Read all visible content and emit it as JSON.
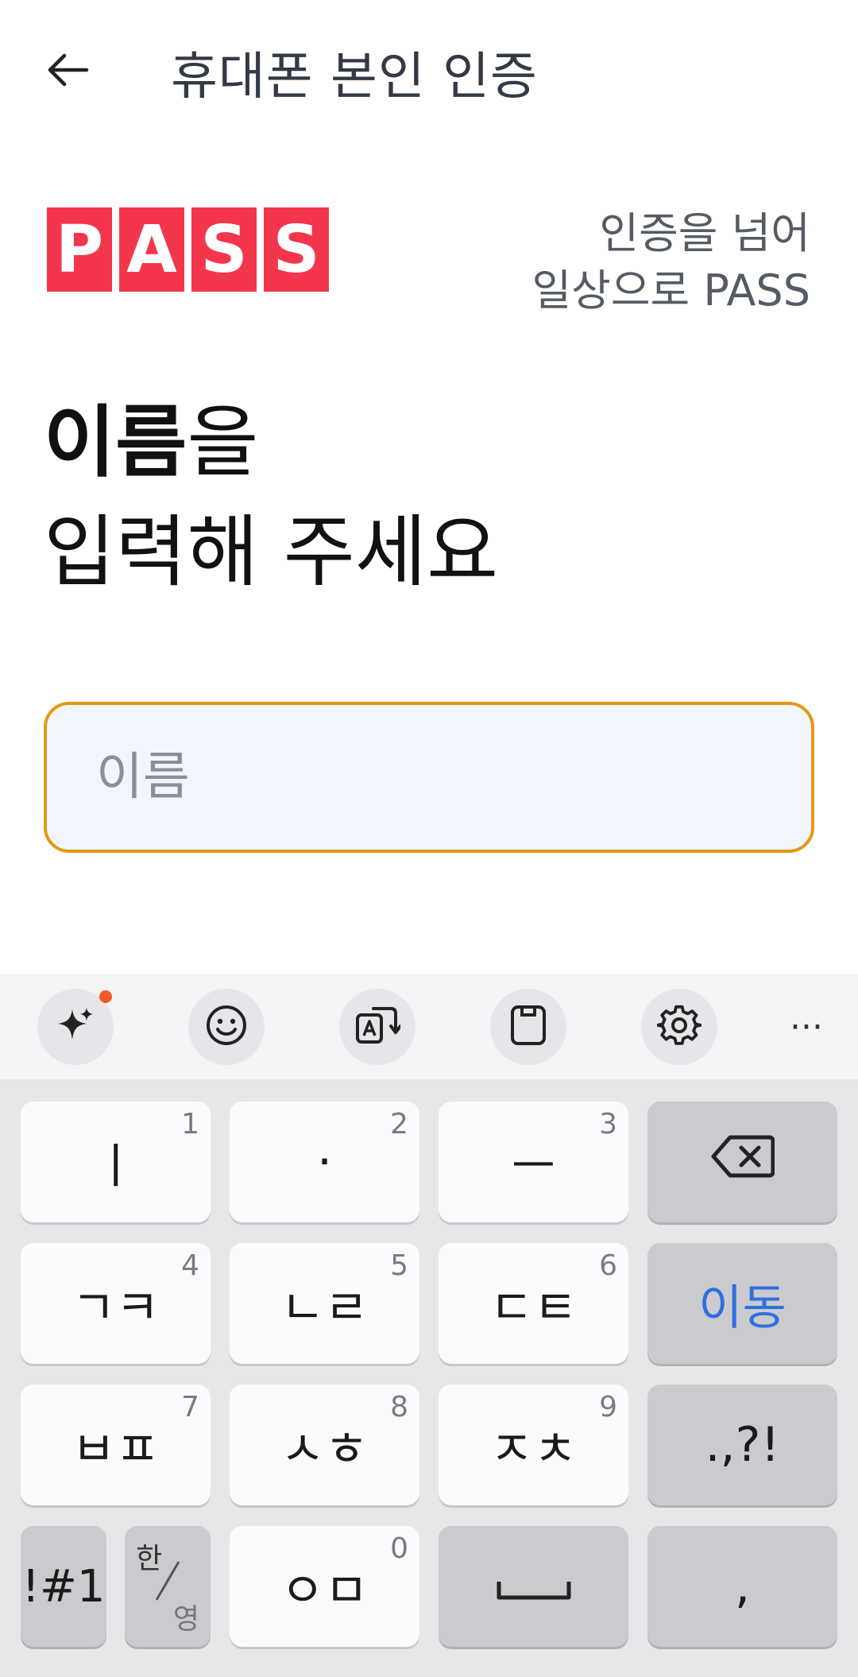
{
  "header": {
    "back_icon": "arrow-left-icon",
    "title": "휴대폰 본인 인증"
  },
  "brand": {
    "logo_letters": [
      "P",
      "A",
      "S",
      "S"
    ],
    "logo_color": "#f4364c",
    "tagline_line1": "인증을 넘어",
    "tagline_line2": "일상으로 PASS"
  },
  "headline": {
    "bold": "이름",
    "rest": "을",
    "line2": "입력해 주세요"
  },
  "name_input": {
    "placeholder": "이름",
    "value": "",
    "border_color": "#e39a12"
  },
  "keyboard_toolbar": {
    "items": [
      "sparkle-ai-icon",
      "emoji-icon",
      "translate-icon",
      "clipboard-icon",
      "settings-gear-icon",
      "more-dots-icon"
    ],
    "more_label": "···"
  },
  "keyboard": {
    "row1": [
      {
        "label": "ㅣ",
        "num": "1"
      },
      {
        "label": "·",
        "num": "2"
      },
      {
        "label": "ㅡ",
        "num": "3"
      }
    ],
    "row2": [
      {
        "label": "ㄱㅋ",
        "num": "4"
      },
      {
        "label": "ㄴㄹ",
        "num": "5"
      },
      {
        "label": "ㄷㅌ",
        "num": "6"
      }
    ],
    "row3": [
      {
        "label": "ㅂㅍ",
        "num": "7"
      },
      {
        "label": "ㅅㅎ",
        "num": "8"
      },
      {
        "label": "ㅈㅊ",
        "num": "9"
      }
    ],
    "row4": [
      {
        "label": "ㅇㅁ",
        "num": "0"
      }
    ],
    "backspace_icon": "backspace-icon",
    "move_label": "이동",
    "punct_label": ".,?!",
    "symbols_label": "!#1",
    "lang_top": "한",
    "lang_bottom": "영",
    "comma_label": ",",
    "space_icon": "space-bar-icon"
  }
}
